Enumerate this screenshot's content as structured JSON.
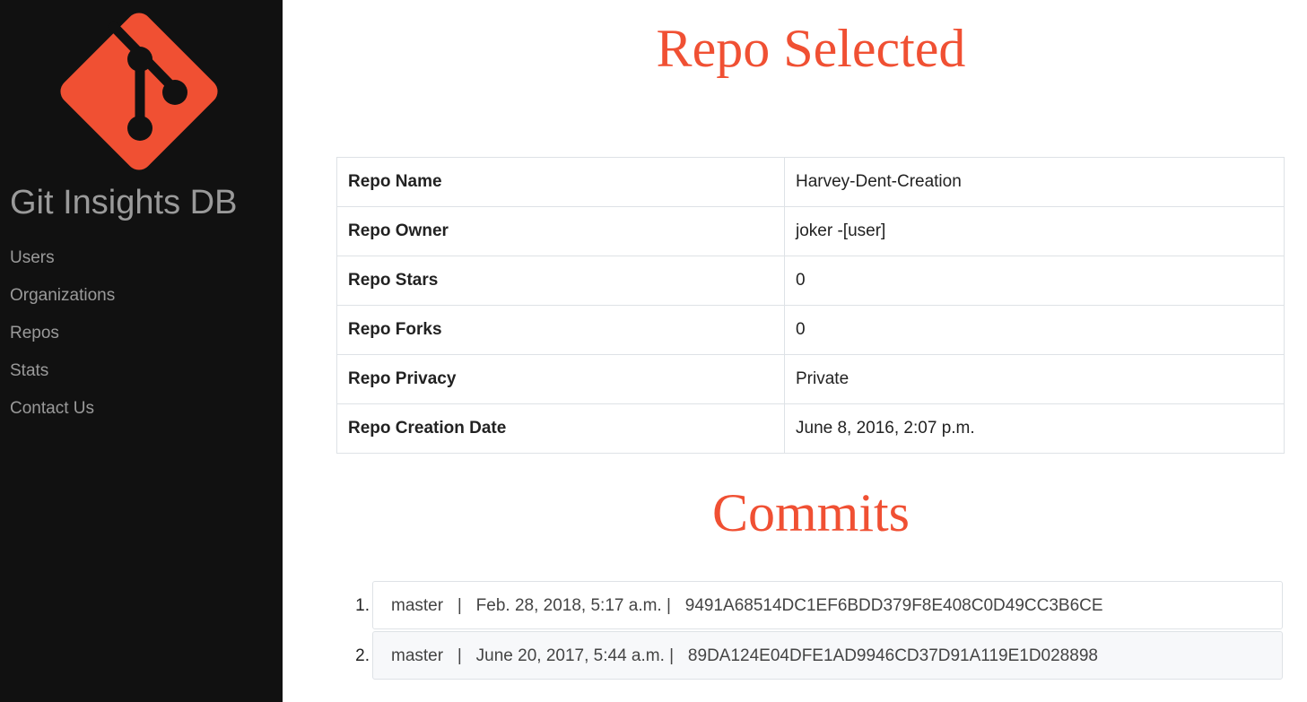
{
  "sidebar": {
    "brand": "Git Insights DB",
    "logo_color": "#f05033",
    "logo_icon": "git-logo-icon",
    "nav": [
      "Users",
      "Organizations",
      "Repos",
      "Stats",
      "Contact Us"
    ]
  },
  "main": {
    "title": "Repo Selected",
    "repo_info": [
      {
        "label": "Repo Name",
        "value": "Harvey-Dent-Creation"
      },
      {
        "label": "Repo Owner",
        "value": "joker -[user]"
      },
      {
        "label": "Repo Stars",
        "value": "0"
      },
      {
        "label": "Repo Forks",
        "value": "0"
      },
      {
        "label": "Repo Privacy",
        "value": "Private"
      },
      {
        "label": "Repo Creation Date",
        "value": "June 8, 2016, 2:07 p.m."
      }
    ],
    "commits_title": "Commits",
    "commits": [
      {
        "number": "1.",
        "text": "master   |   Feb. 28, 2018, 5:17 a.m. |   9491A68514DC1EF6BDD379F8E408C0D49CC3B6CE"
      },
      {
        "number": "2.",
        "text": "master   |   June 20, 2017, 5:44 a.m. |   89DA124E04DFE1AD9946CD37D91A119E1D028898"
      }
    ]
  },
  "colors": {
    "accent": "#f05033",
    "sidebar_bg": "#111111",
    "sidebar_text": "#9a9a9a"
  }
}
